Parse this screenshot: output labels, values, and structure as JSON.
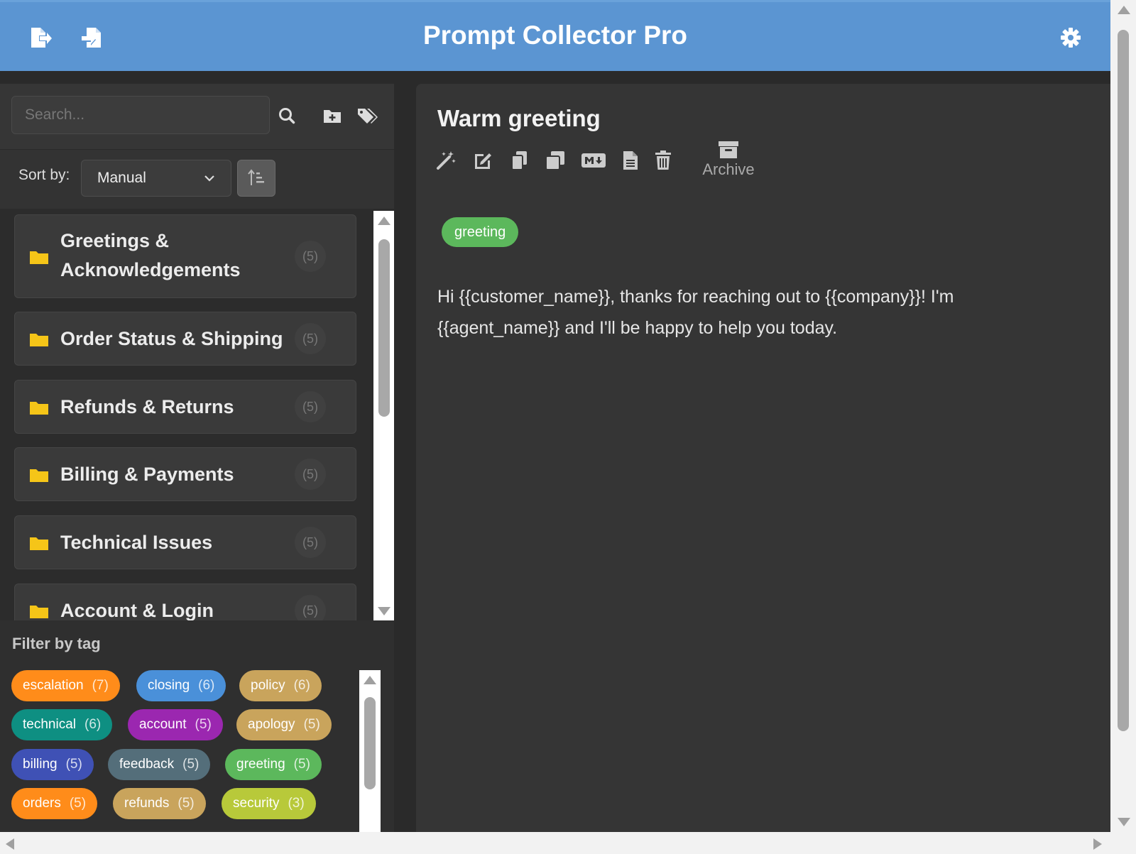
{
  "app": {
    "title": "Prompt Collector Pro",
    "header_color": "#5b95d2",
    "header_icons": [
      "export-icon",
      "import-icon",
      "settings-gear-icon"
    ]
  },
  "sidebar": {
    "search": {
      "placeholder": "Search...",
      "value": ""
    },
    "search_icons": [
      "search-icon",
      "add-folder-icon",
      "tags-icon"
    ],
    "sort": {
      "label": "Sort by:",
      "selected": "Manual",
      "direction_icon": "sort-direction-icon"
    },
    "folders": [
      {
        "name": "Greetings & Acknowledgements",
        "count": "(5)",
        "icon": "folder-icon"
      },
      {
        "name": "Order Status & Shipping",
        "count": "(5)",
        "icon": "folder-icon"
      },
      {
        "name": "Refunds & Returns",
        "count": "(5)",
        "icon": "folder-icon"
      },
      {
        "name": "Billing & Payments",
        "count": "(5)",
        "icon": "folder-icon"
      },
      {
        "name": "Technical Issues",
        "count": "(5)",
        "icon": "folder-icon"
      },
      {
        "name": "Account & Login",
        "count": "(5)",
        "icon": "folder-icon"
      }
    ],
    "filter": {
      "label": "Filter by tag",
      "tags": [
        {
          "name": "escalation",
          "count": "(7)",
          "color": "#ff8c1a"
        },
        {
          "name": "closing",
          "count": "(6)",
          "color": "#4a90d9"
        },
        {
          "name": "policy",
          "count": "(6)",
          "color": "#c9a45c"
        },
        {
          "name": "technical",
          "count": "(6)",
          "color": "#0e8f82"
        },
        {
          "name": "account",
          "count": "(5)",
          "color": "#9b27b0"
        },
        {
          "name": "apology",
          "count": "(5)",
          "color": "#c9a45c"
        },
        {
          "name": "billing",
          "count": "(5)",
          "color": "#3f51b5"
        },
        {
          "name": "feedback",
          "count": "(5)",
          "color": "#546e7a"
        },
        {
          "name": "greeting",
          "count": "(5)",
          "color": "#5cb85c"
        },
        {
          "name": "orders",
          "count": "(5)",
          "color": "#ff8c1a"
        },
        {
          "name": "refunds",
          "count": "(5)",
          "color": "#c9a45c"
        },
        {
          "name": "security",
          "count": "(3)",
          "color": "#b8c93a"
        }
      ]
    }
  },
  "main": {
    "title": "Warm greeting",
    "toolbar_icons": [
      "magic-wand-icon",
      "edit-icon",
      "copy-icon",
      "duplicate-icon",
      "markdown-icon",
      "file-icon",
      "trash-icon",
      "archive-icon"
    ],
    "archive_label": "Archive",
    "tag": {
      "name": "greeting",
      "color": "#5cb85c"
    },
    "content": "Hi {{customer_name}}, thanks for reaching out to {{company}}! I'm {{agent_name}} and I'll be happy to help you today."
  }
}
